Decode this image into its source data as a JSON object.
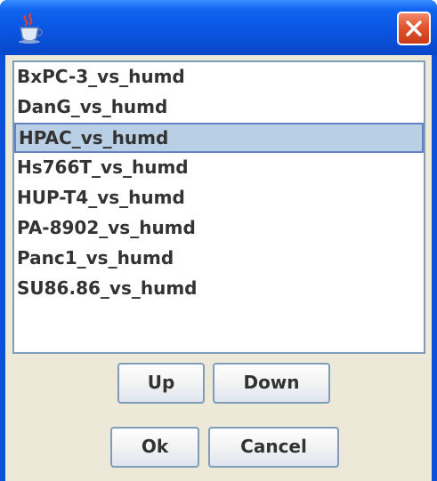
{
  "window": {
    "title": "",
    "icon": "java-coffee-cup-icon",
    "close_icon": "close-x-icon"
  },
  "list": {
    "items": [
      "BxPC-3_vs_humd",
      "DanG_vs_humd",
      "HPAC_vs_humd",
      "Hs766T_vs_humd",
      "HUP-T4_vs_humd",
      "PA-8902_vs_humd",
      "Panc1_vs_humd",
      "SU86.86_vs_humd"
    ],
    "selected": "HPAC_vs_humd"
  },
  "buttons": {
    "up_label": "Up",
    "down_label": "Down",
    "ok_label": "Ok",
    "cancel_label": "Cancel"
  },
  "colors": {
    "titlebar": "#0a55e2",
    "dialog_background": "#ece9d8",
    "selection_background": "#b8cfe5",
    "selection_border": "#6382bf",
    "close_button": "#e2532f"
  }
}
